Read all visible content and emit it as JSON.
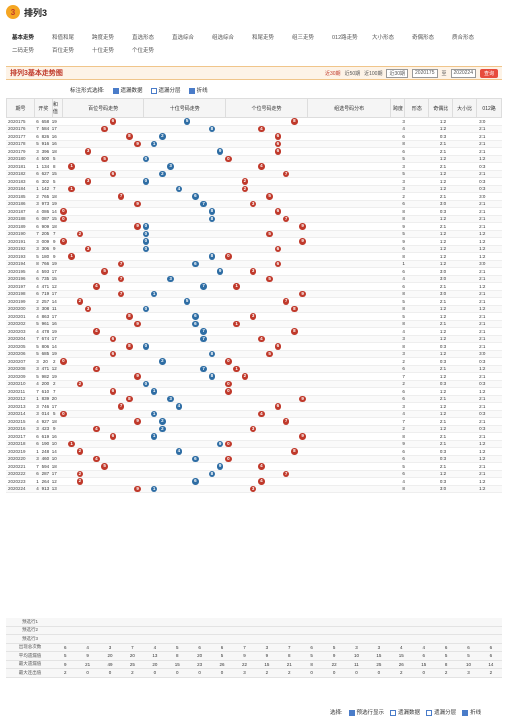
{
  "app": {
    "logo_text": "3",
    "title": "排列3"
  },
  "nav": {
    "row1": [
      "基本走势",
      "和值和尾",
      "跨度走势",
      "直选形态",
      "直选综合",
      "组选综合",
      "和尾走势",
      "组三走势",
      "012路走势",
      "大小形态",
      "奇偶形态",
      "质合形态"
    ],
    "row2": [
      "二码走势",
      "百位走势",
      "十位走势",
      "个位走势"
    ],
    "active": "基本走势"
  },
  "panel": {
    "title": "排列3基本走势图",
    "recent_30": "近30期",
    "recent_50": "近50期",
    "recent_100": "近100期",
    "select_value": "近30期",
    "from_issue": "2020175",
    "to_label": "至",
    "to_issue": "2020224",
    "query_button": "查询"
  },
  "options": {
    "label": "标注形式选择:",
    "items": [
      {
        "label": "遗漏数据",
        "checked": true
      },
      {
        "label": "遗漏分层",
        "checked": false
      },
      {
        "label": "折线",
        "checked": true
      }
    ]
  },
  "table": {
    "headers": {
      "issue": "期号",
      "kaijiang": "开奖",
      "hezhi": "和值",
      "hundreds": "百位号码走势",
      "tens": "十位号码走势",
      "ones": "个位号码走势",
      "group": "组选号码分布",
      "span": "跨度",
      "shape": "形态",
      "odd_even": "奇偶比",
      "big_small": "大小比",
      "r012": "012路"
    },
    "rows": [
      {
        "issue": "2020175",
        "n": "6",
        "code": "658",
        "sum": "19",
        "h": 6,
        "t": 5,
        "o": 8,
        "span": "3",
        "oe": "1:2",
        "bs": "3:0"
      },
      {
        "issue": "2020176",
        "n": "7",
        "code": "584",
        "sum": "17",
        "h": 5,
        "t": 8,
        "o": 4,
        "span": "4",
        "oe": "1:2",
        "bs": "2:1"
      },
      {
        "issue": "2020177",
        "n": "6",
        "code": "826",
        "sum": "16",
        "h": 8,
        "t": 2,
        "o": 6,
        "span": "6",
        "oe": "0:3",
        "bs": "2:1"
      },
      {
        "issue": "2020178",
        "n": "5",
        "code": "916",
        "sum": "16",
        "h": 9,
        "t": 1,
        "o": 6,
        "span": "8",
        "oe": "2:1",
        "bs": "2:1"
      },
      {
        "issue": "2020179",
        "n": "3",
        "code": "396",
        "sum": "18",
        "h": 3,
        "t": 9,
        "o": 6,
        "span": "6",
        "oe": "2:1",
        "bs": "2:1"
      },
      {
        "issue": "2020180",
        "n": "4",
        "code": "500",
        "sum": "5",
        "h": 5,
        "t": 0,
        "o": 0,
        "span": "5",
        "oe": "1:2",
        "bs": "1:2"
      },
      {
        "issue": "2020181",
        "n": "1",
        "code": "134",
        "sum": "8",
        "h": 1,
        "t": 3,
        "o": 4,
        "span": "3",
        "oe": "2:1",
        "bs": "0:3"
      },
      {
        "issue": "2020182",
        "n": "6",
        "code": "627",
        "sum": "15",
        "h": 6,
        "t": 2,
        "o": 7,
        "span": "5",
        "oe": "1:2",
        "bs": "2:1"
      },
      {
        "issue": "2020183",
        "n": "6",
        "code": "302",
        "sum": "5",
        "h": 3,
        "t": 0,
        "o": 2,
        "span": "3",
        "oe": "1:2",
        "bs": "0:3"
      },
      {
        "issue": "2020184",
        "n": "1",
        "code": "142",
        "sum": "7",
        "h": 1,
        "t": 4,
        "o": 2,
        "span": "3",
        "oe": "1:2",
        "bs": "0:3"
      },
      {
        "issue": "2020185",
        "n": "2",
        "code": "765",
        "sum": "18",
        "h": 7,
        "t": 6,
        "o": 5,
        "span": "2",
        "oe": "2:1",
        "bs": "3:0"
      },
      {
        "issue": "2020186",
        "n": "3",
        "code": "973",
        "sum": "19",
        "h": 9,
        "t": 7,
        "o": 3,
        "span": "6",
        "oe": "3:0",
        "bs": "2:1"
      },
      {
        "issue": "2020187",
        "n": "4",
        "code": "086",
        "sum": "14",
        "h": 0,
        "t": 8,
        "o": 6,
        "span": "8",
        "oe": "0:3",
        "bs": "2:1"
      },
      {
        "issue": "2020188",
        "n": "6",
        "code": "087",
        "sum": "15",
        "h": 0,
        "t": 8,
        "o": 7,
        "span": "8",
        "oe": "1:2",
        "bs": "2:1"
      },
      {
        "issue": "2020189",
        "n": "6",
        "code": "909",
        "sum": "18",
        "h": 9,
        "t": 0,
        "o": 9,
        "span": "9",
        "oe": "2:1",
        "bs": "2:1"
      },
      {
        "issue": "2020190",
        "n": "7",
        "code": "205",
        "sum": "7",
        "h": 2,
        "t": 0,
        "o": 5,
        "span": "5",
        "oe": "1:2",
        "bs": "1:2"
      },
      {
        "issue": "2020191",
        "n": "3",
        "code": "009",
        "sum": "9",
        "h": 0,
        "t": 0,
        "o": 9,
        "span": "9",
        "oe": "1:2",
        "bs": "1:2"
      },
      {
        "issue": "2020192",
        "n": "3",
        "code": "306",
        "sum": "9",
        "h": 3,
        "t": 0,
        "o": 6,
        "span": "6",
        "oe": "1:2",
        "bs": "1:2"
      },
      {
        "issue": "2020193",
        "n": "5",
        "code": "180",
        "sum": "9",
        "h": 1,
        "t": 8,
        "o": 0,
        "span": "8",
        "oe": "1:2",
        "bs": "1:2"
      },
      {
        "issue": "2020194",
        "n": "8",
        "code": "766",
        "sum": "19",
        "h": 7,
        "t": 6,
        "o": 6,
        "span": "1",
        "oe": "1:2",
        "bs": "3:0"
      },
      {
        "issue": "2020195",
        "n": "4",
        "code": "593",
        "sum": "17",
        "h": 5,
        "t": 9,
        "o": 3,
        "span": "6",
        "oe": "3:0",
        "bs": "2:1"
      },
      {
        "issue": "2020196",
        "n": "6",
        "code": "735",
        "sum": "15",
        "h": 7,
        "t": 3,
        "o": 5,
        "span": "4",
        "oe": "3:0",
        "bs": "2:1"
      },
      {
        "issue": "2020197",
        "n": "4",
        "code": "471",
        "sum": "12",
        "h": 4,
        "t": 7,
        "o": 1,
        "span": "6",
        "oe": "2:1",
        "bs": "1:2"
      },
      {
        "issue": "2020198",
        "n": "6",
        "code": "719",
        "sum": "17",
        "h": 7,
        "t": 1,
        "o": 9,
        "span": "8",
        "oe": "3:0",
        "bs": "2:1"
      },
      {
        "issue": "2020199",
        "n": "2",
        "code": "257",
        "sum": "14",
        "h": 2,
        "t": 5,
        "o": 7,
        "span": "5",
        "oe": "2:1",
        "bs": "2:1"
      },
      {
        "issue": "2020200",
        "n": "3",
        "code": "308",
        "sum": "11",
        "h": 3,
        "t": 0,
        "o": 8,
        "span": "8",
        "oe": "1:2",
        "bs": "1:2"
      },
      {
        "issue": "2020201",
        "n": "4",
        "code": "863",
        "sum": "17",
        "h": 8,
        "t": 6,
        "o": 3,
        "span": "5",
        "oe": "1:2",
        "bs": "2:1"
      },
      {
        "issue": "2020202",
        "n": "5",
        "code": "961",
        "sum": "16",
        "h": 9,
        "t": 6,
        "o": 1,
        "span": "8",
        "oe": "2:1",
        "bs": "2:1"
      },
      {
        "issue": "2020203",
        "n": "4",
        "code": "478",
        "sum": "19",
        "h": 4,
        "t": 7,
        "o": 8,
        "span": "4",
        "oe": "1:2",
        "bs": "2:1"
      },
      {
        "issue": "2020204",
        "n": "7",
        "code": "674",
        "sum": "17",
        "h": 6,
        "t": 7,
        "o": 4,
        "span": "3",
        "oe": "1:2",
        "bs": "2:1"
      },
      {
        "issue": "2020205",
        "n": "5",
        "code": "806",
        "sum": "14",
        "h": 8,
        "t": 0,
        "o": 6,
        "span": "8",
        "oe": "0:3",
        "bs": "2:1"
      },
      {
        "issue": "2020206",
        "n": "5",
        "code": "685",
        "sum": "19",
        "h": 6,
        "t": 8,
        "o": 5,
        "span": "3",
        "oe": "1:2",
        "bs": "3:0"
      },
      {
        "issue": "2020207",
        "n": "3",
        "code": "20",
        "sum": "2",
        "h": 0,
        "t": 2,
        "o": 0,
        "span": "2",
        "oe": "0:3",
        "bs": "0:3"
      },
      {
        "issue": "2020208",
        "n": "3",
        "code": "471",
        "sum": "12",
        "h": 4,
        "t": 7,
        "o": 1,
        "span": "6",
        "oe": "2:1",
        "bs": "1:2"
      },
      {
        "issue": "2020209",
        "n": "5",
        "code": "982",
        "sum": "19",
        "h": 9,
        "t": 8,
        "o": 2,
        "span": "7",
        "oe": "1:2",
        "bs": "2:1"
      },
      {
        "issue": "2020210",
        "n": "4",
        "code": "200",
        "sum": "2",
        "h": 2,
        "t": 0,
        "o": 0,
        "span": "2",
        "oe": "0:3",
        "bs": "0:3"
      },
      {
        "issue": "2020211",
        "n": "7",
        "code": "610",
        "sum": "7",
        "h": 6,
        "t": 1,
        "o": 0,
        "span": "6",
        "oe": "1:2",
        "bs": "1:2"
      },
      {
        "issue": "2020212",
        "n": "1",
        "code": "839",
        "sum": "20",
        "h": 8,
        "t": 3,
        "o": 9,
        "span": "6",
        "oe": "2:1",
        "bs": "2:1"
      },
      {
        "issue": "2020213",
        "n": "3",
        "code": "746",
        "sum": "17",
        "h": 7,
        "t": 4,
        "o": 6,
        "span": "3",
        "oe": "1:2",
        "bs": "2:1"
      },
      {
        "issue": "2020214",
        "n": "3",
        "code": "014",
        "sum": "5",
        "h": 0,
        "t": 1,
        "o": 4,
        "span": "4",
        "oe": "1:2",
        "bs": "0:3"
      },
      {
        "issue": "2020215",
        "n": "4",
        "code": "927",
        "sum": "18",
        "h": 9,
        "t": 2,
        "o": 7,
        "span": "7",
        "oe": "2:1",
        "bs": "2:1"
      },
      {
        "issue": "2020216",
        "n": "3",
        "code": "423",
        "sum": "9",
        "h": 4,
        "t": 2,
        "o": 3,
        "span": "2",
        "oe": "1:2",
        "bs": "0:3"
      },
      {
        "issue": "2020217",
        "n": "6",
        "code": "619",
        "sum": "16",
        "h": 6,
        "t": 1,
        "o": 9,
        "span": "8",
        "oe": "2:1",
        "bs": "2:1"
      },
      {
        "issue": "2020218",
        "n": "6",
        "code": "190",
        "sum": "10",
        "h": 1,
        "t": 9,
        "o": 0,
        "span": "9",
        "oe": "2:1",
        "bs": "1:2"
      },
      {
        "issue": "2020219",
        "n": "1",
        "code": "248",
        "sum": "14",
        "h": 2,
        "t": 4,
        "o": 8,
        "span": "6",
        "oe": "0:3",
        "bs": "1:2"
      },
      {
        "issue": "2020220",
        "n": "3",
        "code": "460",
        "sum": "10",
        "h": 4,
        "t": 6,
        "o": 0,
        "span": "6",
        "oe": "0:3",
        "bs": "1:2"
      },
      {
        "issue": "2020221",
        "n": "7",
        "code": "594",
        "sum": "18",
        "h": 5,
        "t": 9,
        "o": 4,
        "span": "5",
        "oe": "2:1",
        "bs": "2:1"
      },
      {
        "issue": "2020222",
        "n": "6",
        "code": "287",
        "sum": "17",
        "h": 2,
        "t": 8,
        "o": 7,
        "span": "6",
        "oe": "1:2",
        "bs": "2:1"
      },
      {
        "issue": "2020223",
        "n": "1",
        "code": "264",
        "sum": "12",
        "h": 2,
        "t": 6,
        "o": 4,
        "span": "4",
        "oe": "0:3",
        "bs": "1:2"
      },
      {
        "issue": "2020224",
        "n": "4",
        "code": "913",
        "sum": "13",
        "h": 9,
        "t": 1,
        "o": 3,
        "span": "8",
        "oe": "3:0",
        "bs": "1:2"
      }
    ],
    "forecast_rows": [
      "预选行1",
      "预选行2",
      "预选行3"
    ],
    "stats": [
      {
        "label": "出现总次数",
        "values": [
          "6",
          "4",
          "3",
          "7",
          "4",
          "5",
          "6",
          "6",
          "7",
          "3",
          "7",
          "6",
          "5",
          "3",
          "3",
          "4",
          "4",
          "6",
          "6",
          "6"
        ]
      },
      {
        "label": "平均遗漏值",
        "values": [
          "5",
          "9",
          "20",
          "20",
          "13",
          "8",
          "20",
          "5",
          "9",
          "9",
          "8",
          "5",
          "9",
          "10",
          "15",
          "15",
          "6",
          "5",
          "5",
          "6"
        ]
      },
      {
        "label": "最大遗漏值",
        "values": [
          "9",
          "21",
          "49",
          "25",
          "20",
          "15",
          "23",
          "26",
          "22",
          "15",
          "21",
          "8",
          "22",
          "11",
          "25",
          "26",
          "15",
          "8",
          "10",
          "14"
        ]
      },
      {
        "label": "最大连出值",
        "values": [
          "2",
          "0",
          "0",
          "2",
          "0",
          "0",
          "0",
          "0",
          "3",
          "2",
          "2",
          "0",
          "0",
          "0",
          "0",
          "2",
          "0",
          "2",
          "3",
          "2"
        ]
      }
    ]
  },
  "footer": {
    "label": "选择:",
    "items": [
      {
        "label": "预选行显示",
        "checked": true
      },
      {
        "label": "遗漏数据",
        "checked": false
      },
      {
        "label": "遗漏分层",
        "checked": false
      },
      {
        "label": "折线",
        "checked": true
      }
    ]
  }
}
